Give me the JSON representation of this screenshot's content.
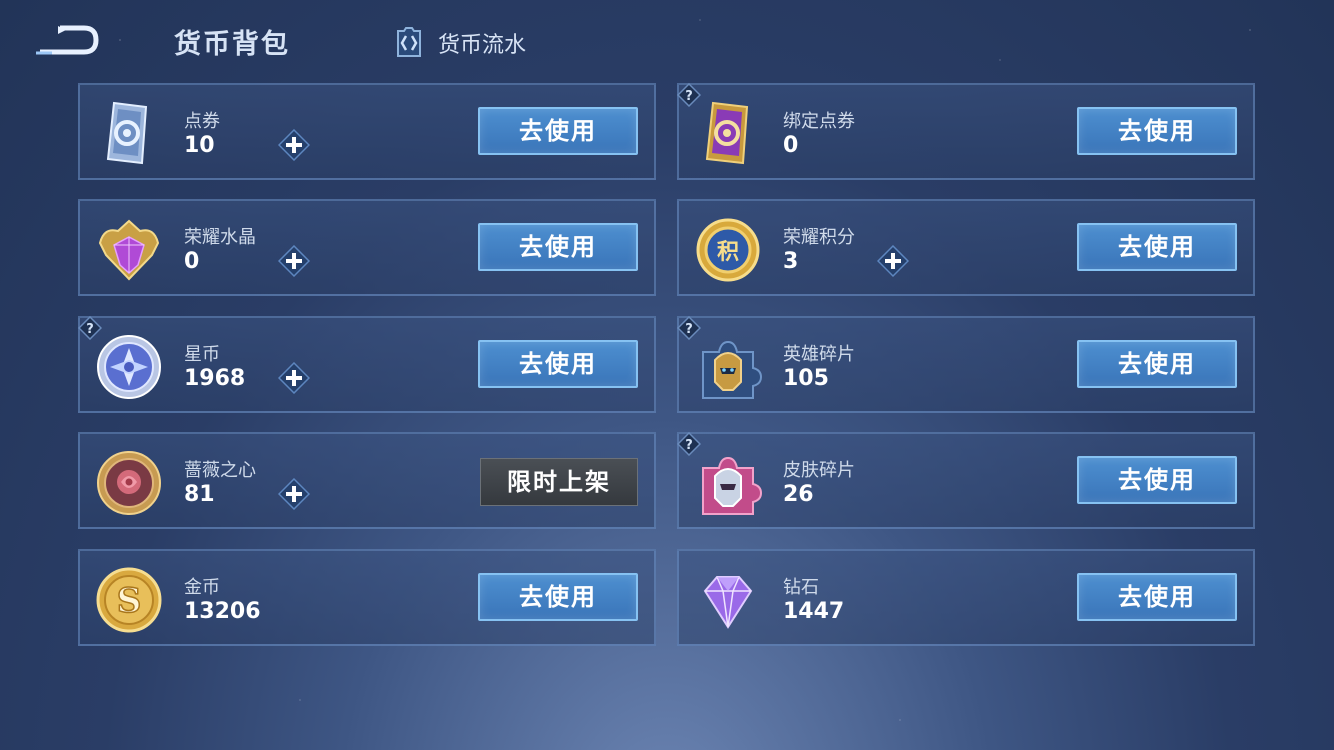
{
  "header": {
    "title": "货币背包",
    "ledger_label": "货币流水"
  },
  "cards": [
    {
      "name": "点券",
      "value": "10",
      "button": "去使用",
      "icon": "ticket-icon"
    },
    {
      "name": "绑定点券",
      "value": "0",
      "button": "去使用",
      "icon": "bound-ticket-icon"
    },
    {
      "name": "荣耀水晶",
      "value": "0",
      "button": "去使用",
      "icon": "crystal-icon"
    },
    {
      "name": "荣耀积分",
      "value": "3",
      "button": "去使用",
      "icon": "honor-points-icon"
    },
    {
      "name": "星币",
      "value": "1968",
      "button": "去使用",
      "icon": "star-coin-icon"
    },
    {
      "name": "英雄碎片",
      "value": "105",
      "button": "去使用",
      "icon": "hero-fragment-icon"
    },
    {
      "name": "蔷薇之心",
      "value": "81",
      "button": "限时上架",
      "icon": "rose-heart-icon"
    },
    {
      "name": "皮肤碎片",
      "value": "26",
      "button": "去使用",
      "icon": "skin-fragment-icon"
    },
    {
      "name": "金币",
      "value": "13206",
      "button": "去使用",
      "icon": "gold-coin-icon"
    },
    {
      "name": "钻石",
      "value": "1447",
      "button": "去使用",
      "icon": "diamond-icon"
    }
  ],
  "colors": {
    "accent": "#4d8fd0",
    "card_border": "#78a0d7",
    "background": "#2a3d66"
  }
}
